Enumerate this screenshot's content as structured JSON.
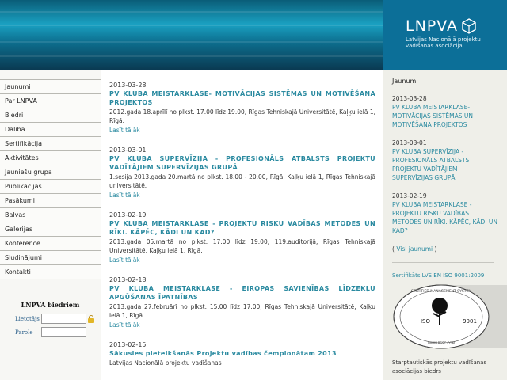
{
  "brand": {
    "logo": "LNPVA",
    "subtitle": "Latvijas Nacionālā projektu vadīšanas asociācija"
  },
  "nav": [
    "Jaunumi",
    "Par LNPVA",
    "Biedri",
    "Dalība",
    "Sertifikācija",
    "Aktivitātes",
    "Jauniešu grupa",
    "Publikācijas",
    "Pasākumi",
    "Balvas",
    "Galerijas",
    "Konference",
    "Sludinājumi",
    "Kontakti"
  ],
  "login": {
    "title": "LNPVA biedriem",
    "user_label": "Lietotājs",
    "password_label": "Parole"
  },
  "posts": [
    {
      "date": "2013-03-28",
      "title": "PV KLUBA MEISTARKLASE- MOTIVĀCIJAS SISTĒMAS UN MOTIVĒŠANA PROJEKTOS",
      "body": "2012.gada 18.aprīlī no plkst. 17.00 līdz 19.00, Rīgas Tehniskajā Universitātē, Kaļķu ielā 1, Rīgā.",
      "more": "Lasīt tālāk"
    },
    {
      "date": "2013-03-01",
      "title": "PV KLUBA SUPERVĪZIJA - PROFESIONĀLS ATBALSTS PROJEKTU VADĪTĀJIEM SUPERVĪZIJAS GRUPĀ",
      "body": "1.sesija 2013.gada 20.martā no plkst. 18.00 - 20.00, Rīgā, Kaļķu ielā 1, Rīgas Tehniskajā universitātē.",
      "more": "Lasīt tālāk"
    },
    {
      "date": "2013-02-19",
      "title": "PV KLUBA MEISTARKLASE - PROJEKTU RISKU VADĪBAS METODES UN RĪKI. KĀPĒC, KĀDI UN KAD?",
      "body": "2013.gada 05.martā no plkst. 17.00 līdz 19.00, 119.auditorijā, Rīgas Tehniskajā Universitātē, Kaļķu ielā 1, Rīgā.",
      "more": "Lasīt tālāk"
    },
    {
      "date": "2013-02-18",
      "title": "PV KLUBA MEISTARKLASE - EIROPAS SAVIENĪBAS LĪDZEKĻU APGŪŠANAS ĪPATNĪBAS",
      "body": "2013.gada 27.februārī no plkst. 15.00 līdz 17.00, Rīgas Tehniskajā Universitātē, Kaļķu ielā 1, Rīgā.",
      "more": "Lasīt tālāk"
    },
    {
      "date": "2013-02-15",
      "title": "Sākusies pieteikšanās Projektu vadības čempionātam 2013",
      "body": "Latvijas Nacionālā projektu vadīšanas",
      "more": ""
    }
  ],
  "right": {
    "heading": "Jaunumi",
    "news": [
      {
        "date": "2013-03-28",
        "title": "PV KLUBA MEISTARKLASE- MOTIVĀCIJAS SISTĒMAS UN MOTIVĒŠANA PROJEKTOS"
      },
      {
        "date": "2013-03-01",
        "title": "PV KLUBA SUPERVĪZIJA - PROFESIONĀLS ATBALSTS PROJEKTU VADĪTĀJIEM SUPERVĪZIJAS GRUPĀ"
      },
      {
        "date": "2013-02-19",
        "title": "PV KLUBA MEISTARKLASE - PROJEKTU RISKU VADĪBAS METODES UN RĪKI. KĀPĒC, KĀDI UN KAD?"
      }
    ],
    "all_open": "(",
    "all_link": "Visi jaunumi",
    "all_close": ")",
    "cert_label": "Sertifikāts LVS EN ISO 9001:2009",
    "cert_badge": {
      "top_text": "CERTIFIED MANAGEMENT SYSTEM",
      "iso": "ISO",
      "number": "9001",
      "bottom_text": "WWW.BSSC.COM"
    },
    "member_text": "Starptautiskās projektu vadīšanas asociācijas biedrs"
  },
  "colors": {
    "accent": "#2a8aa0",
    "header": "#0c6f98"
  }
}
